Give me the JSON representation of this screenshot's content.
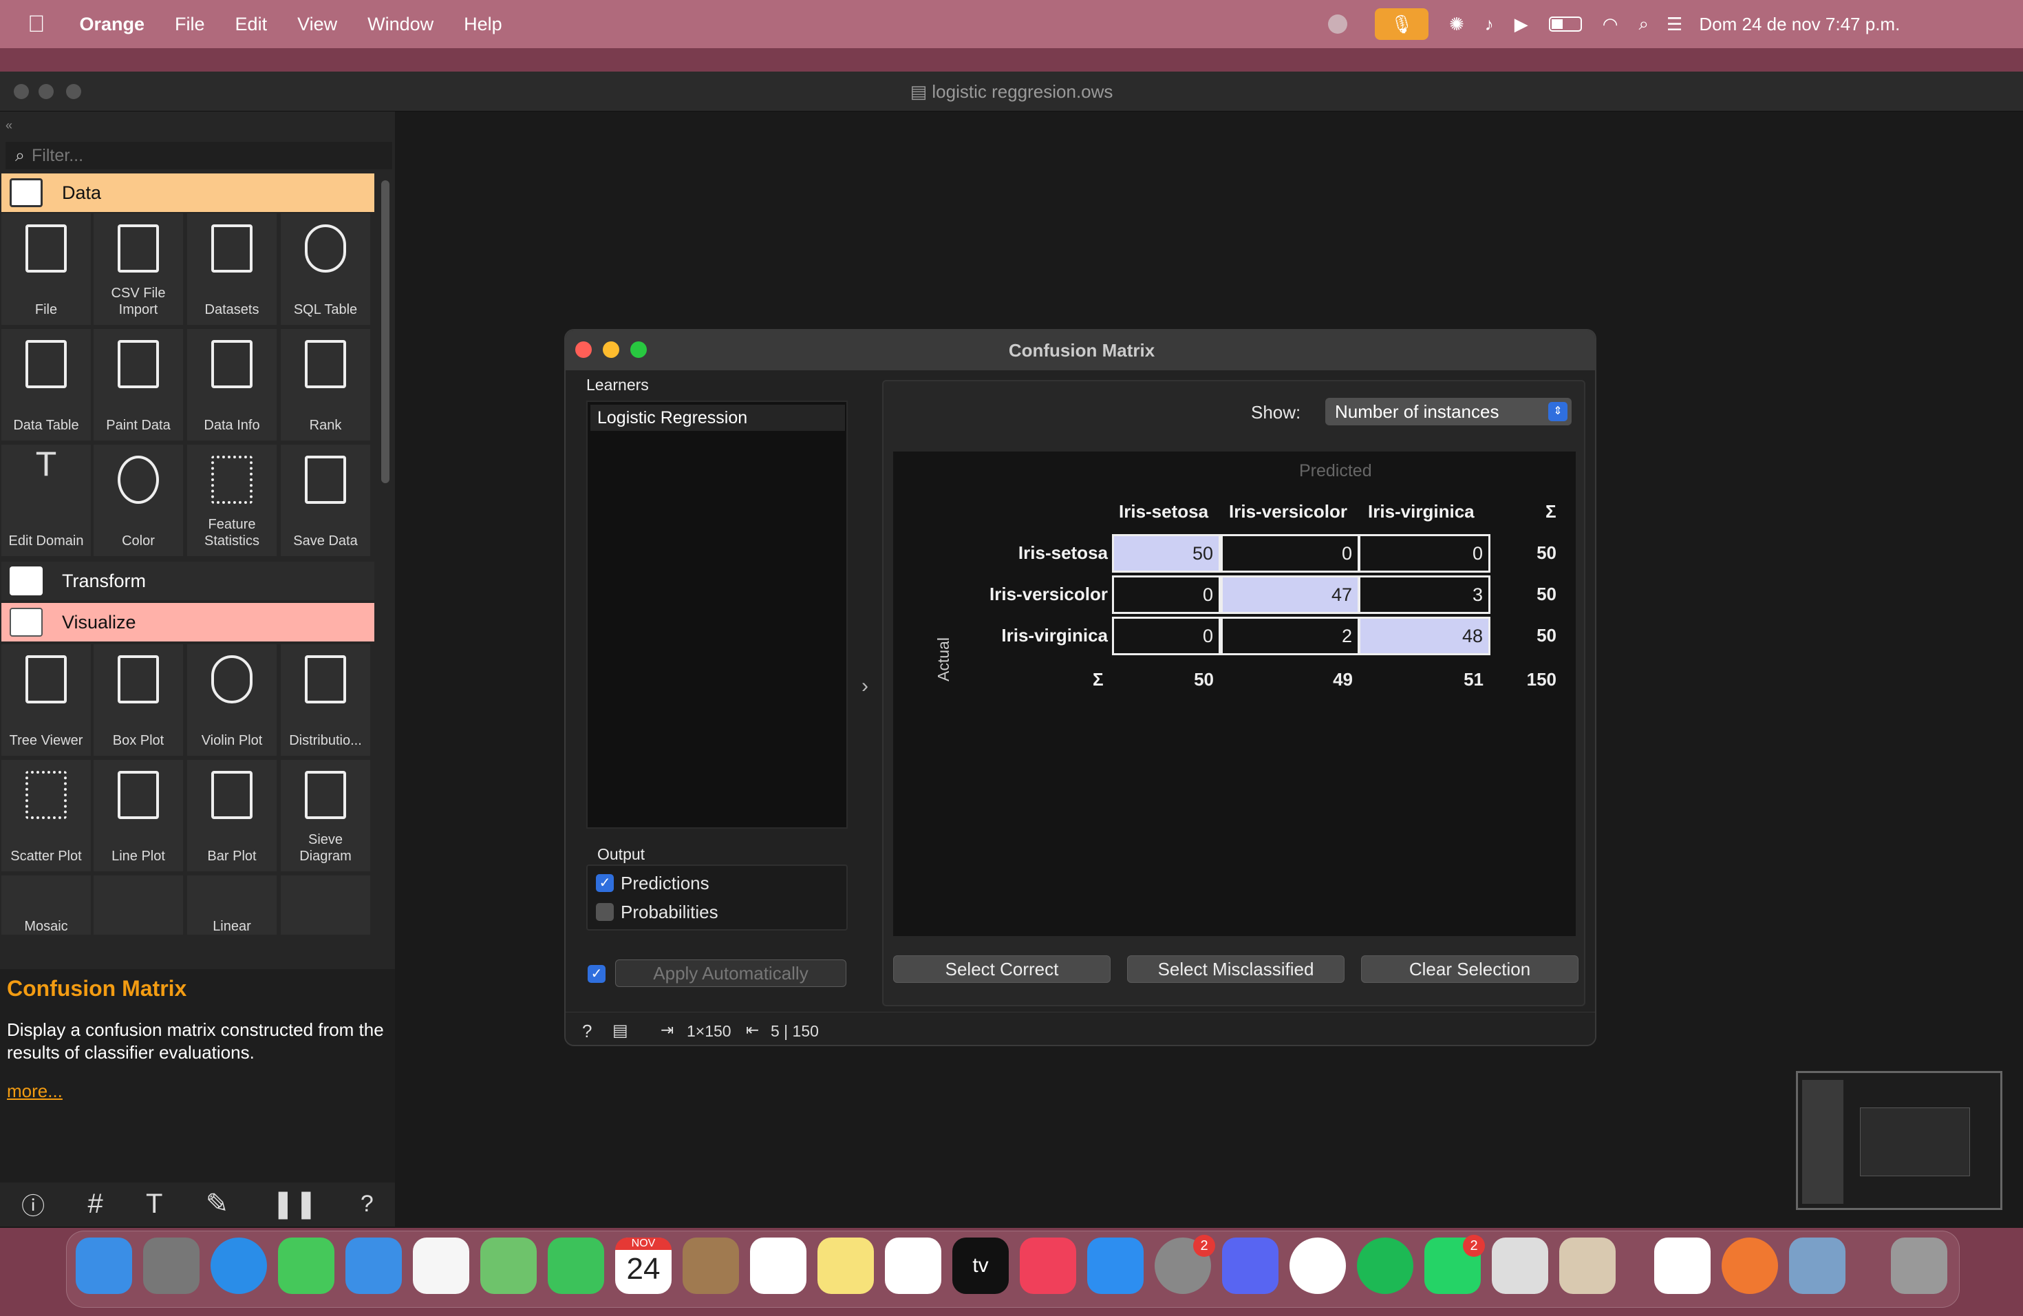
{
  "menubar": {
    "app": "Orange",
    "items": [
      "File",
      "Edit",
      "View",
      "Window",
      "Help"
    ],
    "clock": "Dom 24 de nov  7:47 p.m."
  },
  "window": {
    "title": "logistic reggresion.ows"
  },
  "sidebar": {
    "filter_placeholder": "Filter...",
    "categories": {
      "data": "Data",
      "transform": "Transform",
      "visualize": "Visualize"
    },
    "data_widgets": [
      "File",
      "CSV File Import",
      "Datasets",
      "SQL Table",
      "Data Table",
      "Paint Data",
      "Data Info",
      "Rank",
      "Edit Domain",
      "Color",
      "Feature Statistics",
      "Save Data"
    ],
    "viz_widgets": [
      "Tree Viewer",
      "Box Plot",
      "Violin Plot",
      "Distributio...",
      "Scatter Plot",
      "Line Plot",
      "Bar Plot",
      "Sieve Diagram",
      "Mosaic",
      "",
      "Linear",
      ""
    ],
    "description": {
      "title": "Confusion Matrix",
      "text": "Display a confusion matrix constructed from the results of classifier evaluations.",
      "more": "more..."
    }
  },
  "dialog": {
    "title": "Confusion Matrix",
    "learners_label": "Learners",
    "learner": "Logistic Regression",
    "output_label": "Output",
    "predictions": "Predictions",
    "predictions_checked": true,
    "probabilities": "Probabilities",
    "probabilities_checked": false,
    "apply_auto": "Apply Automatically",
    "show_label": "Show:",
    "show_value": "Number of instances",
    "predicted_label": "Predicted",
    "actual_label": "Actual",
    "sigma": "Σ",
    "classes": [
      "Iris-setosa",
      "Iris-versicolor",
      "Iris-virginica"
    ],
    "matrix": [
      [
        50,
        0,
        0
      ],
      [
        0,
        47,
        3
      ],
      [
        0,
        2,
        48
      ]
    ],
    "row_sums": [
      50,
      50,
      50
    ],
    "col_sums": [
      50,
      49,
      51
    ],
    "total": 150,
    "buttons": {
      "select_correct": "Select Correct",
      "select_misclassified": "Select Misclassified",
      "clear_selection": "Clear Selection"
    },
    "status": {
      "input": "1×150",
      "output": "5 | 150"
    }
  },
  "dock": {
    "calendar_month": "NOV",
    "calendar_day": "24",
    "tv": "tv",
    "badges": {
      "settings": "2",
      "whatsapp": "2"
    }
  },
  "colors": {
    "accent_orange": "#f39c12",
    "data_cat": "#fbc98a",
    "visualize_cat": "#ffb1a9",
    "diag_cell": "#cdd0f4"
  }
}
